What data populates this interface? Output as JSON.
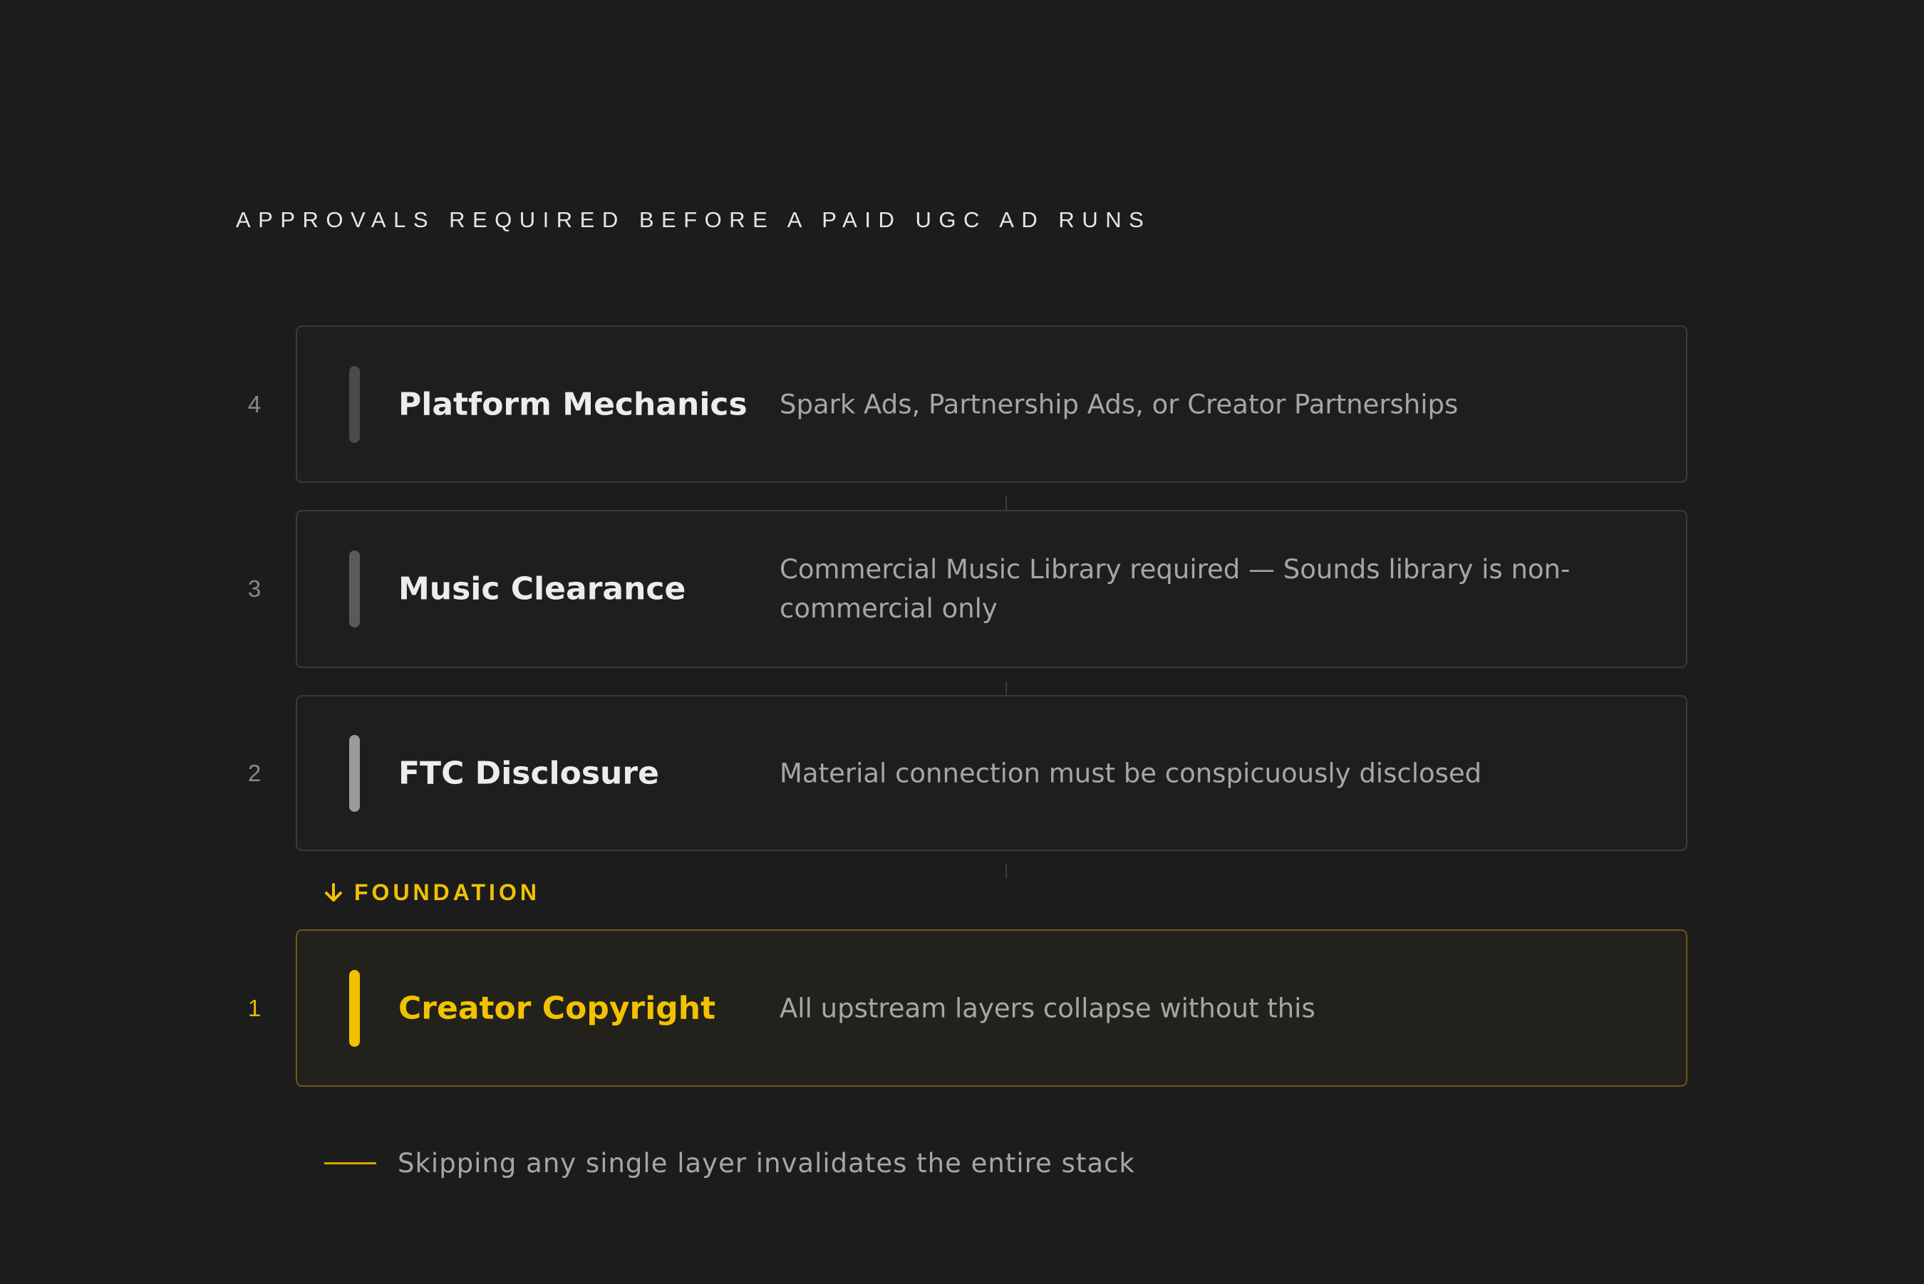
{
  "heading": "APPROVALS REQUIRED BEFORE A PAID UGC AD RUNS",
  "layers": [
    {
      "number": "4",
      "name": "Platform Mechanics",
      "description": "Spark Ads, Partnership Ads, or Creator Partnerships",
      "accent_color": "#4a4a4a"
    },
    {
      "number": "3",
      "name": "Music Clearance",
      "description": "Commercial Music Library required — Sounds library is non-commercial only",
      "accent_color": "#5a5a5a"
    },
    {
      "number": "2",
      "name": "FTC Disclosure",
      "description": "Material connection must be conspicuously disclosed",
      "accent_color": "#9a9a9a"
    },
    {
      "number": "1",
      "name": "Creator Copyright",
      "description": "All upstream layers collapse without this",
      "accent_color": "#f2c200"
    }
  ],
  "foundation_label": "FOUNDATION",
  "footnote": "Skipping any single layer invalidates the entire stack",
  "colors": {
    "background": "#1c1c1c",
    "accent": "#f2c200"
  }
}
